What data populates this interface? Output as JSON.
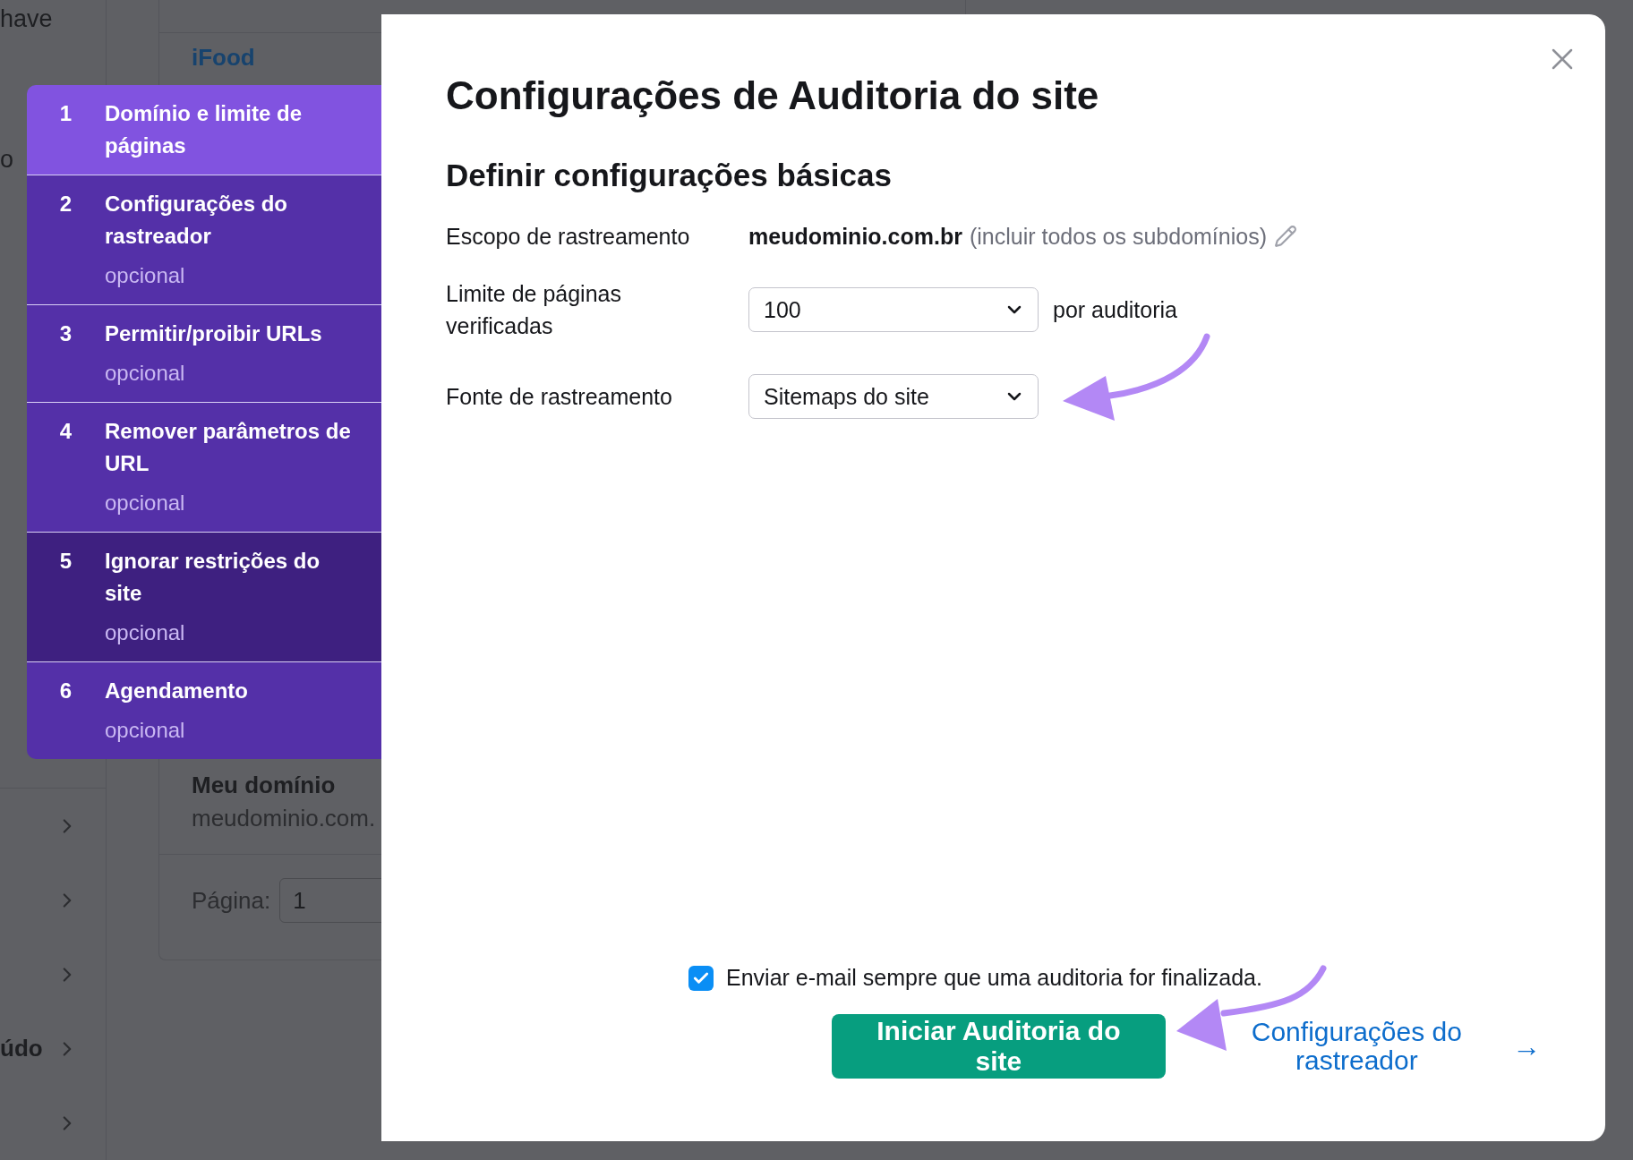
{
  "background": {
    "sidebar_texts": [
      "have",
      "o"
    ],
    "sidebar_rows": [
      {
        "label": ""
      },
      {
        "label": ""
      },
      {
        "label": ""
      },
      {
        "label": "údo"
      },
      {
        "label": ""
      }
    ],
    "card": {
      "site_name": "iFood",
      "domain_title": "Meu domínio",
      "domain_url": "meudominio.com.",
      "page_label": "Página:",
      "page_value": "1"
    }
  },
  "steps": [
    {
      "number": "1",
      "title": "Domínio e limite de páginas",
      "selected": true,
      "hovered": false
    },
    {
      "number": "2",
      "title": "Configurações do rastreador",
      "subtitle": "opcional",
      "selected": false,
      "hovered": false
    },
    {
      "number": "3",
      "title": "Permitir/proibir URLs",
      "subtitle": "opcional",
      "selected": false,
      "hovered": false
    },
    {
      "number": "4",
      "title": "Remover parâmetros de URL",
      "subtitle": "opcional",
      "selected": false,
      "hovered": false
    },
    {
      "number": "5",
      "title": "Ignorar restrições do site",
      "subtitle": "opcional",
      "selected": false,
      "hovered": true
    },
    {
      "number": "6",
      "title": "Agendamento",
      "subtitle": "opcional",
      "selected": false,
      "hovered": false
    }
  ],
  "modal": {
    "title": "Configurações de Auditoria do site",
    "section_title": "Definir configurações básicas",
    "scope": {
      "label": "Escopo de rastreamento",
      "domain": "meudominio.com.br",
      "note": "(incluir todos os subdomínios)"
    },
    "fields": [
      {
        "label": "Limite de páginas verificadas",
        "value": "100",
        "suffix": "por auditoria"
      },
      {
        "label": "Fonte de rastreamento",
        "value": "Sitemaps do site"
      }
    ],
    "email_checkbox": {
      "label": "Enviar e-mail sempre que uma auditoria for finalizada.",
      "checked": true
    },
    "start_button": "Iniciar Auditoria do site",
    "next_link": "Configurações do rastreador",
    "next_arrow": "→"
  }
}
